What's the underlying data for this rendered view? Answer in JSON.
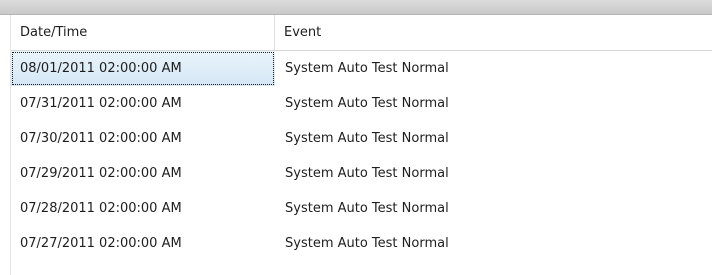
{
  "grid": {
    "columns": [
      "Date/Time",
      "Event"
    ],
    "rows": [
      {
        "datetime": "08/01/2011 02:00:00 AM",
        "event": "System Auto Test Normal",
        "selected": true
      },
      {
        "datetime": "07/31/2011 02:00:00 AM",
        "event": "System Auto Test Normal",
        "selected": false
      },
      {
        "datetime": "07/30/2011 02:00:00 AM",
        "event": "System Auto Test Normal",
        "selected": false
      },
      {
        "datetime": "07/29/2011 02:00:00 AM",
        "event": "System Auto Test Normal",
        "selected": false
      },
      {
        "datetime": "07/28/2011 02:00:00 AM",
        "event": "System Auto Test Normal",
        "selected": false
      },
      {
        "datetime": "07/27/2011 02:00:00 AM",
        "event": "System Auto Test Normal",
        "selected": false
      }
    ]
  },
  "colors": {
    "selection": "#d4e7f5",
    "header_border": "#d6d6d6"
  }
}
